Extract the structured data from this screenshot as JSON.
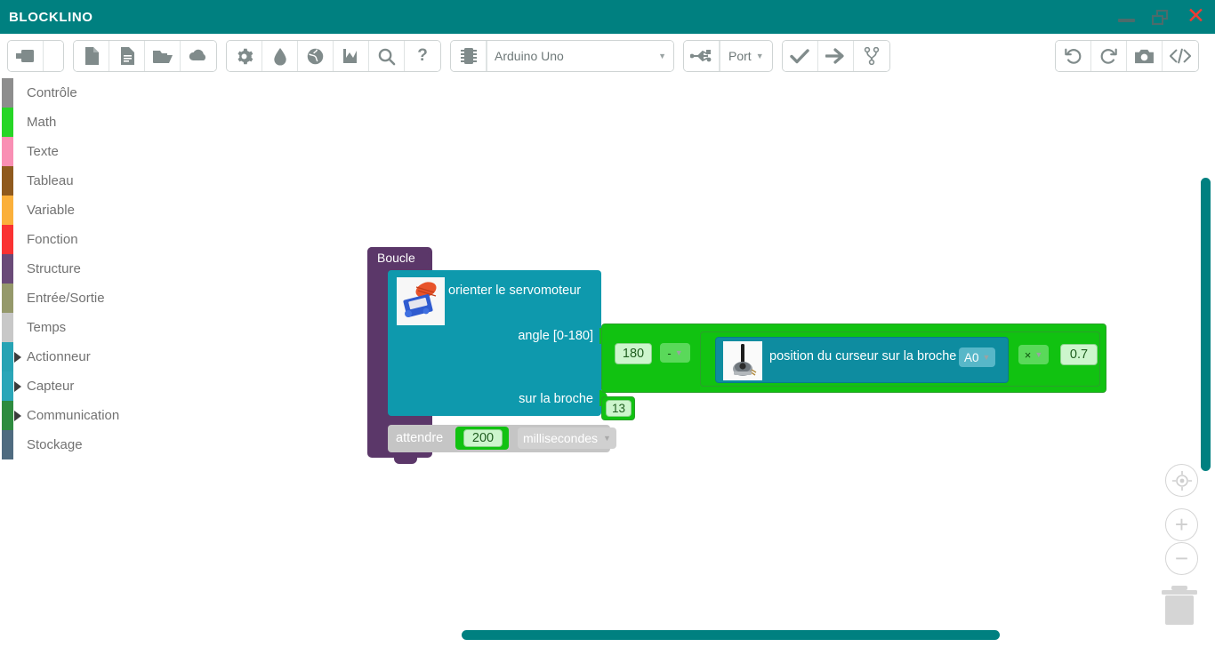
{
  "titlebar": {
    "app_name": "BLOCKLINO",
    "brand_color": "#008080",
    "close_color": "#ef3b33",
    "controls": [
      {
        "name": "minimize-button",
        "label": "—"
      },
      {
        "name": "restore-button",
        "label": "❐"
      },
      {
        "name": "close-button",
        "label": "✕"
      }
    ]
  },
  "toolbar": {
    "groups": [
      {
        "name": "view-group",
        "buttons": [
          {
            "icon": "panel-toggle-icon",
            "label": ""
          },
          {
            "icon": "panel-edge-icon",
            "label": ""
          }
        ]
      },
      {
        "name": "file-group",
        "buttons": [
          {
            "icon": "new-file-icon",
            "label": ""
          },
          {
            "icon": "example-file-icon",
            "label": ""
          },
          {
            "icon": "open-folder-icon",
            "label": ""
          },
          {
            "icon": "save-cloud-icon",
            "label": ""
          }
        ]
      },
      {
        "name": "settings-group",
        "buttons": [
          {
            "icon": "gear-icon",
            "label": ""
          },
          {
            "icon": "droplet-icon",
            "label": ""
          },
          {
            "icon": "globe-icon",
            "label": ""
          },
          {
            "icon": "chart-icon",
            "label": ""
          },
          {
            "icon": "search-icon",
            "label": ""
          },
          {
            "icon": "help-icon",
            "label": "?"
          }
        ]
      },
      {
        "name": "board-group",
        "buttons": [
          {
            "icon": "chip-icon",
            "label": ""
          }
        ]
      },
      {
        "name": "connection-group",
        "buttons": [
          {
            "icon": "usb-icon",
            "label": ""
          }
        ]
      },
      {
        "name": "compile-group",
        "buttons": [
          {
            "icon": "verify-check-icon",
            "label": ""
          },
          {
            "icon": "upload-arrow-icon",
            "label": ""
          },
          {
            "icon": "branch-icon",
            "label": ""
          }
        ]
      },
      {
        "name": "history-group",
        "buttons": [
          {
            "icon": "undo-icon",
            "label": ""
          },
          {
            "icon": "redo-icon",
            "label": ""
          },
          {
            "icon": "camera-icon",
            "label": ""
          },
          {
            "icon": "code-icon",
            "label": "</>"
          }
        ]
      }
    ],
    "board_select": {
      "value": "Arduino Uno",
      "placeholder": "Arduino Uno"
    },
    "port_select": {
      "value": "Port"
    }
  },
  "sidebar": {
    "items": [
      {
        "label": "Contrôle",
        "color": "#8d8d8d",
        "expandable": false
      },
      {
        "label": "Math",
        "color": "#26d626",
        "expandable": false
      },
      {
        "label": "Texte",
        "color": "#f98fb4",
        "expandable": false
      },
      {
        "label": "Tableau",
        "color": "#8f5a1e",
        "expandable": false
      },
      {
        "label": "Variable",
        "color": "#fbb03b",
        "expandable": false
      },
      {
        "label": "Fonction",
        "color": "#fa3232",
        "expandable": false
      },
      {
        "label": "Structure",
        "color": "#6a4a78",
        "expandable": false
      },
      {
        "label": "Entrée/Sortie",
        "color": "#95996b",
        "expandable": false
      },
      {
        "label": "Temps",
        "color": "#c8c8c8",
        "expandable": false
      },
      {
        "label": "Actionneur",
        "color": "#27a3b4",
        "expandable": true
      },
      {
        "label": "Capteur",
        "color": "#2ba6b8",
        "expandable": true
      },
      {
        "label": "Communication",
        "color": "#2e8b3f",
        "expandable": true
      },
      {
        "label": "Stockage",
        "color": "#4f6b80",
        "expandable": false
      }
    ]
  },
  "workspace": {
    "loop_block": {
      "name": "boucle-block",
      "label": "Boucle",
      "color": "#5b3769"
    },
    "servo_block": {
      "name": "servo-block",
      "color": "#0e99ad",
      "title": "orienter le servomoteur",
      "angle_label": "angle [0-180]",
      "pin_label": "sur la broche",
      "pin_value": "13",
      "image": "servo-motor-icon"
    },
    "math_block": {
      "name": "math-subtract-block",
      "color": "#11c211",
      "left_value": "180",
      "operator": "-"
    },
    "mult_block": {
      "name": "math-multiply-block",
      "color": "#11c211",
      "operator": "×",
      "right_value": "0.7"
    },
    "sensor_block": {
      "name": "potentiometer-read-block",
      "color": "#0e8ca0",
      "label": "position du curseur sur la broche",
      "pin_value": "A0",
      "image": "potentiometer-icon"
    },
    "wait_block": {
      "name": "wait-block",
      "color": "#c5c5c5",
      "label": "attendre",
      "value": "200",
      "unit": "millisecondes"
    }
  },
  "controls": {
    "zoom_center": {
      "name": "zoom-center-button",
      "glyph": "◎"
    },
    "zoom_in": {
      "name": "zoom-in-button",
      "glyph": "+"
    },
    "zoom_out": {
      "name": "zoom-out-button",
      "glyph": "−"
    },
    "trash": {
      "name": "trash-icon",
      "glyph": "🗑"
    }
  }
}
